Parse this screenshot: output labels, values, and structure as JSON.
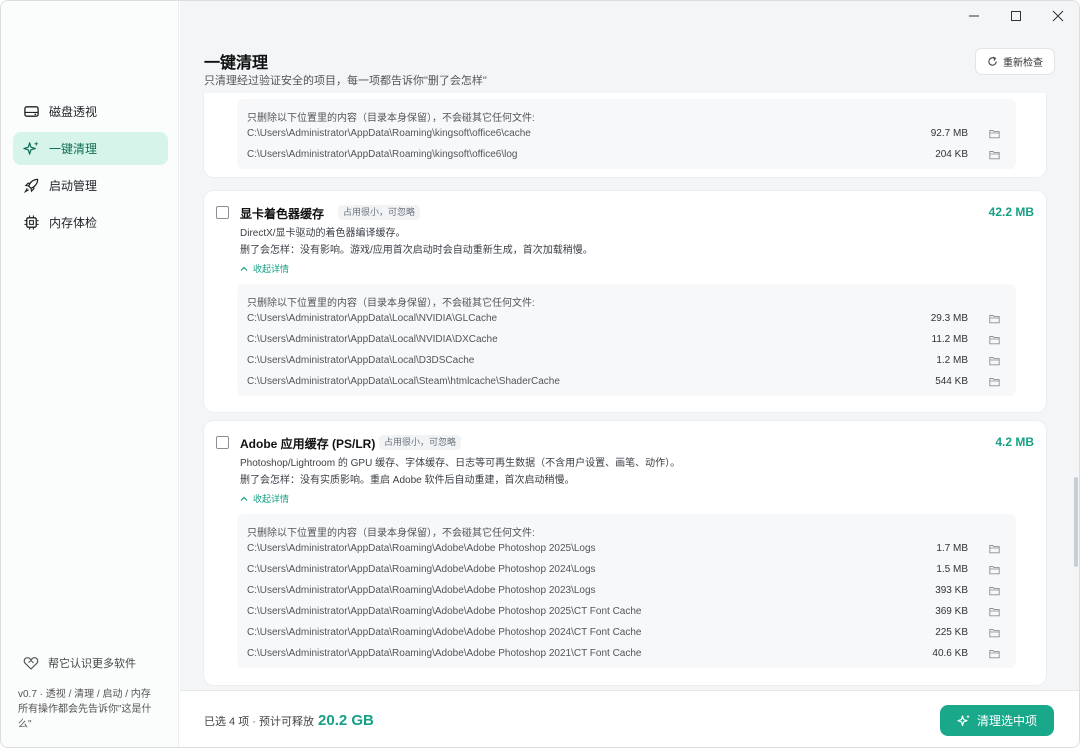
{
  "sidebar": {
    "items": [
      {
        "label": "磁盘透视",
        "icon": "disk-icon",
        "active": false
      },
      {
        "label": "一键清理",
        "icon": "sparkle-icon",
        "active": true
      },
      {
        "label": "启动管理",
        "icon": "rocket-icon",
        "active": false
      },
      {
        "label": "内存体检",
        "icon": "chip-icon",
        "active": false
      }
    ],
    "help_label": "帮它认识更多软件",
    "footer_line1": "v0.7 · 透视 / 清理 / 启动 / 内存",
    "footer_line2": "所有操作都会先告诉你\"这是什",
    "footer_line3": "么\""
  },
  "header": {
    "title": "一键清理",
    "subtitle": "只清理经过验证安全的项目，每一项都告诉你\"删了会怎样\"",
    "recheck_label": "重新检查"
  },
  "cards": [
    {
      "details_intro": "只删除以下位置里的内容（目录本身保留），不会碰其它任何文件:",
      "paths": [
        {
          "path": "C:\\Users\\Administrator\\AppData\\Roaming\\kingsoft\\office6\\cache",
          "size": "92.7 MB"
        },
        {
          "path": "C:\\Users\\Administrator\\AppData\\Roaming\\kingsoft\\office6\\log",
          "size": "204 KB"
        }
      ]
    },
    {
      "title": "显卡着色器缓存",
      "tag": "占用很小，可忽略",
      "size": "42.2 MB",
      "desc": "DirectX/显卡驱动的着色器编译缓存。",
      "impact": "删了会怎样：没有影响。游戏/应用首次启动时会自动重新生成，首次加载稍慢。",
      "toggle": "收起详情",
      "details_intro": "只删除以下位置里的内容（目录本身保留），不会碰其它任何文件:",
      "paths": [
        {
          "path": "C:\\Users\\Administrator\\AppData\\Local\\NVIDIA\\GLCache",
          "size": "29.3 MB"
        },
        {
          "path": "C:\\Users\\Administrator\\AppData\\Local\\NVIDIA\\DXCache",
          "size": "11.2 MB"
        },
        {
          "path": "C:\\Users\\Administrator\\AppData\\Local\\D3DSCache",
          "size": "1.2 MB"
        },
        {
          "path": "C:\\Users\\Administrator\\AppData\\Local\\Steam\\htmlcache\\ShaderCache",
          "size": "544 KB"
        }
      ]
    },
    {
      "title": "Adobe 应用缓存 (PS/LR)",
      "tag": "占用很小，可忽略",
      "size": "4.2 MB",
      "desc": "Photoshop/Lightroom 的 GPU 缓存、字体缓存、日志等可再生数据（不含用户设置、画笔、动作）。",
      "impact": "删了会怎样：没有实质影响。重启 Adobe 软件后自动重建，首次启动稍慢。",
      "toggle": "收起详情",
      "details_intro": "只删除以下位置里的内容（目录本身保留），不会碰其它任何文件:",
      "paths": [
        {
          "path": "C:\\Users\\Administrator\\AppData\\Roaming\\Adobe\\Adobe Photoshop 2025\\Logs",
          "size": "1.7 MB"
        },
        {
          "path": "C:\\Users\\Administrator\\AppData\\Roaming\\Adobe\\Adobe Photoshop 2024\\Logs",
          "size": "1.5 MB"
        },
        {
          "path": "C:\\Users\\Administrator\\AppData\\Roaming\\Adobe\\Adobe Photoshop 2023\\Logs",
          "size": "393 KB"
        },
        {
          "path": "C:\\Users\\Administrator\\AppData\\Roaming\\Adobe\\Adobe Photoshop 2025\\CT Font Cache",
          "size": "369 KB"
        },
        {
          "path": "C:\\Users\\Administrator\\AppData\\Roaming\\Adobe\\Adobe Photoshop 2024\\CT Font Cache",
          "size": "225 KB"
        },
        {
          "path": "C:\\Users\\Administrator\\AppData\\Roaming\\Adobe\\Adobe Photoshop 2021\\CT Font Cache",
          "size": "40.6 KB"
        }
      ]
    }
  ],
  "footer": {
    "summary": "已选 4 项 · 预计可释放",
    "total": "20.2 GB",
    "clean_label": "清理选中项"
  },
  "colors": {
    "accent": "#16a085",
    "active_nav_bg": "#d7f4ea",
    "button_bg": "#1aa88a"
  }
}
